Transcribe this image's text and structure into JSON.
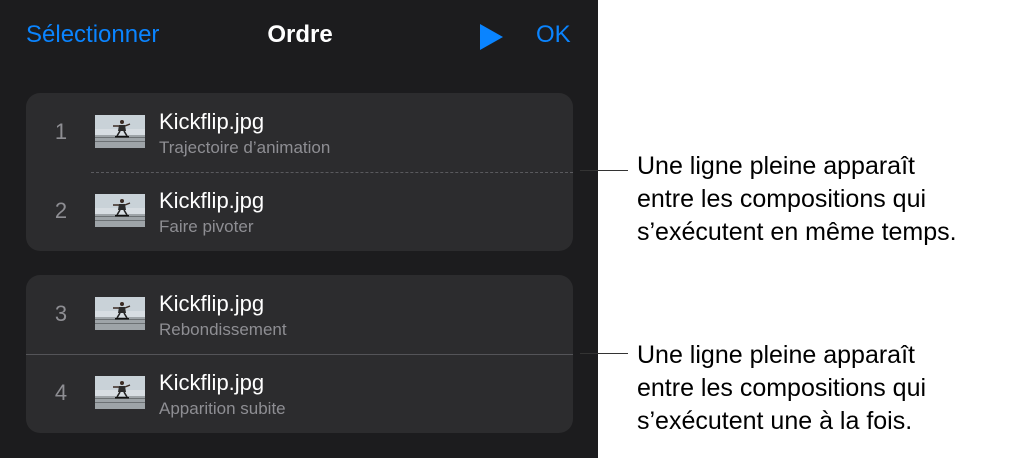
{
  "navbar": {
    "select_label": "Sélectionner",
    "title": "Ordre",
    "play_icon": "play-icon",
    "ok_label": "OK",
    "accent_color": "#0a84ff"
  },
  "groups": [
    {
      "separator": "dashed",
      "rows": [
        {
          "number": "1",
          "title": "Kickflip.jpg",
          "subtitle": "Trajectoire d’animation"
        },
        {
          "number": "2",
          "title": "Kickflip.jpg",
          "subtitle": "Faire pivoter"
        }
      ]
    },
    {
      "separator": "solid",
      "rows": [
        {
          "number": "3",
          "title": "Kickflip.jpg",
          "subtitle": "Rebondissement"
        },
        {
          "number": "4",
          "title": "Kickflip.jpg",
          "subtitle": "Apparition subite"
        }
      ]
    }
  ],
  "callouts": [
    {
      "lines": [
        "Une ligne pleine apparaît",
        "entre les compositions qui",
        "s’exécutent en même temps."
      ]
    },
    {
      "lines": [
        "Une ligne pleine apparaît",
        "entre les compositions qui",
        "s’exécutent une à la fois."
      ]
    }
  ],
  "colors": {
    "panel_background": "#1c1c1e",
    "group_background": "#2c2c2e",
    "secondary_text": "#8e8e93"
  }
}
